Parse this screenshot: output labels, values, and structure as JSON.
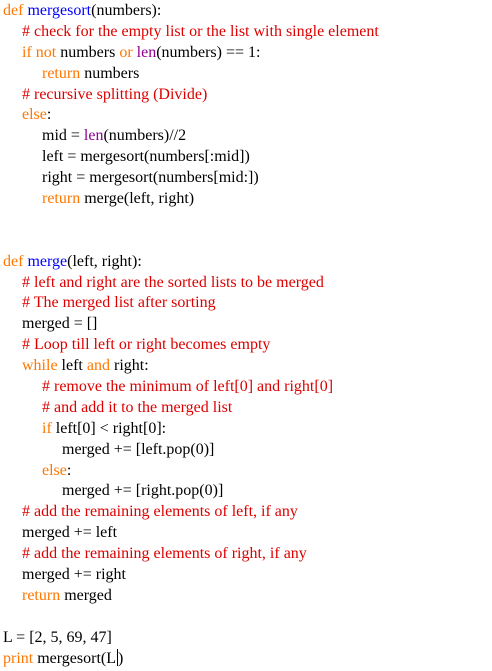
{
  "colors": {
    "keyword": "#ff7700",
    "builtin": "#900090",
    "comment": "#dd0000",
    "funcname": "#0000ff",
    "default": "#000000",
    "background": "#ffffff"
  },
  "editor": {
    "lines": [
      {
        "indent": 0,
        "tokens": [
          {
            "t": "def ",
            "c": "keyword"
          },
          {
            "t": "mergesort",
            "c": "funcname"
          },
          {
            "t": "(numbers):",
            "c": "default"
          }
        ]
      },
      {
        "indent": 1,
        "tokens": [
          {
            "t": "# check for the empty list or the list with single element",
            "c": "comment"
          }
        ]
      },
      {
        "indent": 1,
        "tokens": [
          {
            "t": "if not ",
            "c": "keyword"
          },
          {
            "t": "numbers ",
            "c": "default"
          },
          {
            "t": "or ",
            "c": "keyword"
          },
          {
            "t": "len",
            "c": "builtin"
          },
          {
            "t": "(numbers) == 1:",
            "c": "default"
          }
        ]
      },
      {
        "indent": 2,
        "tokens": [
          {
            "t": "return ",
            "c": "keyword"
          },
          {
            "t": "numbers",
            "c": "default"
          }
        ]
      },
      {
        "indent": 1,
        "tokens": [
          {
            "t": "# recursive splitting (Divide)",
            "c": "comment"
          }
        ]
      },
      {
        "indent": 1,
        "tokens": [
          {
            "t": "else",
            "c": "keyword"
          },
          {
            "t": ":",
            "c": "default"
          }
        ]
      },
      {
        "indent": 2,
        "tokens": [
          {
            "t": "mid = ",
            "c": "default"
          },
          {
            "t": "len",
            "c": "builtin"
          },
          {
            "t": "(numbers)//2",
            "c": "default"
          }
        ]
      },
      {
        "indent": 2,
        "tokens": [
          {
            "t": "left = mergesort(numbers[:mid])",
            "c": "default"
          }
        ]
      },
      {
        "indent": 2,
        "tokens": [
          {
            "t": "right = mergesort(numbers[mid:])",
            "c": "default"
          }
        ]
      },
      {
        "indent": 2,
        "tokens": [
          {
            "t": "return ",
            "c": "keyword"
          },
          {
            "t": "merge(left, right)",
            "c": "default"
          }
        ]
      },
      {
        "indent": 0,
        "tokens": []
      },
      {
        "indent": 0,
        "tokens": []
      },
      {
        "indent": 0,
        "tokens": [
          {
            "t": "def ",
            "c": "keyword"
          },
          {
            "t": "merge",
            "c": "funcname"
          },
          {
            "t": "(left, right):",
            "c": "default"
          }
        ]
      },
      {
        "indent": 1,
        "tokens": [
          {
            "t": "# left and right are the sorted lists to be merged",
            "c": "comment"
          }
        ]
      },
      {
        "indent": 1,
        "tokens": [
          {
            "t": "# The merged list after sorting",
            "c": "comment"
          }
        ]
      },
      {
        "indent": 1,
        "tokens": [
          {
            "t": "merged = []",
            "c": "default"
          }
        ]
      },
      {
        "indent": 1,
        "tokens": [
          {
            "t": "# Loop till left or right becomes empty",
            "c": "comment"
          }
        ]
      },
      {
        "indent": 1,
        "tokens": [
          {
            "t": "while ",
            "c": "keyword"
          },
          {
            "t": "left ",
            "c": "default"
          },
          {
            "t": "and ",
            "c": "keyword"
          },
          {
            "t": "right:",
            "c": "default"
          }
        ]
      },
      {
        "indent": 2,
        "tokens": [
          {
            "t": "# remove the minimum of left[0] and right[0]",
            "c": "comment"
          }
        ]
      },
      {
        "indent": 2,
        "tokens": [
          {
            "t": "# and add it to the merged list",
            "c": "comment"
          }
        ]
      },
      {
        "indent": 2,
        "tokens": [
          {
            "t": "if ",
            "c": "keyword"
          },
          {
            "t": "left[0] < right[0]:",
            "c": "default"
          }
        ]
      },
      {
        "indent": 3,
        "tokens": [
          {
            "t": "merged += [left.pop(0)]",
            "c": "default"
          }
        ]
      },
      {
        "indent": 2,
        "tokens": [
          {
            "t": "else",
            "c": "keyword"
          },
          {
            "t": ":",
            "c": "default"
          }
        ]
      },
      {
        "indent": 3,
        "tokens": [
          {
            "t": "merged += [right.pop(0)]",
            "c": "default"
          }
        ]
      },
      {
        "indent": 1,
        "tokens": [
          {
            "t": "# add the remaining elements of left, if any",
            "c": "comment"
          }
        ]
      },
      {
        "indent": 1,
        "tokens": [
          {
            "t": "merged += left",
            "c": "default"
          }
        ]
      },
      {
        "indent": 1,
        "tokens": [
          {
            "t": "# add the remaining elements of right, if any",
            "c": "comment"
          }
        ]
      },
      {
        "indent": 1,
        "tokens": [
          {
            "t": "merged += right",
            "c": "default"
          }
        ]
      },
      {
        "indent": 1,
        "tokens": [
          {
            "t": "return ",
            "c": "keyword"
          },
          {
            "t": "merged",
            "c": "default"
          }
        ]
      },
      {
        "indent": 0,
        "tokens": []
      },
      {
        "indent": 0,
        "tokens": [
          {
            "t": "L = [2, 5, 69, 47]",
            "c": "default"
          }
        ]
      },
      {
        "indent": 0,
        "tokens": [
          {
            "t": "print ",
            "c": "keyword"
          },
          {
            "t": "mergesort(L",
            "c": "default"
          },
          {
            "t": "|",
            "c": "caret"
          },
          {
            "t": ")",
            "c": "default"
          }
        ]
      }
    ]
  }
}
